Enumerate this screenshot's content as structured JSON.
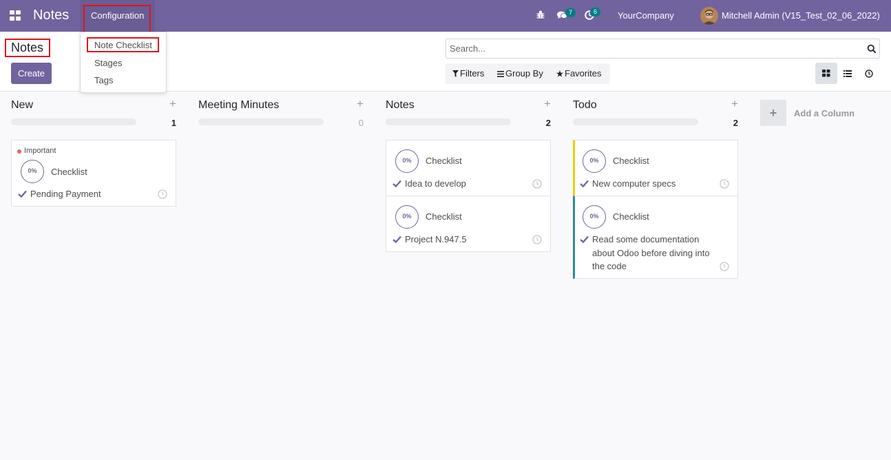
{
  "navbar": {
    "app_name": "Notes",
    "menu_configuration": "Configuration",
    "messages_count": "7",
    "activities_count": "6",
    "company": "YourCompany",
    "user": "Mitchell Admin (V15_Test_02_06_2022)"
  },
  "config_menu": {
    "items": [
      "Note Checklist",
      "Stages",
      "Tags"
    ]
  },
  "control_panel": {
    "title": "Notes",
    "create_label": "Create",
    "search_placeholder": "Search...",
    "filters_label": "Filters",
    "group_by_label": "Group By",
    "favorites_label": "Favorites"
  },
  "columns": [
    {
      "title": "New",
      "count": "1",
      "cards": [
        {
          "tag": "Important",
          "progress": "0%",
          "label": "Checklist",
          "text": "Pending Payment"
        }
      ]
    },
    {
      "title": "Meeting Minutes",
      "count": "0",
      "cards": []
    },
    {
      "title": "Notes",
      "count": "2",
      "cards": [
        {
          "progress": "0%",
          "label": "Checklist",
          "text": "Idea to develop"
        },
        {
          "progress": "0%",
          "label": "Checklist",
          "text": "Project N.947.5"
        }
      ]
    },
    {
      "title": "Todo",
      "count": "2",
      "cards": [
        {
          "progress": "0%",
          "label": "Checklist",
          "text": "New computer specs",
          "color": "#f3cc00"
        },
        {
          "progress": "0%",
          "label": "Checklist",
          "text": "Read some documentation about Odoo before diving into the code",
          "color": "#2e8c9a"
        }
      ]
    }
  ],
  "add_column_label": "Add a Column",
  "colors": {
    "brand": "#71639e",
    "badge": "#017e84",
    "highlight": "#e0131b",
    "important": "#f06050"
  },
  "icons": [
    "apps-icon",
    "bug-icon",
    "chat-icon",
    "activity-clock-icon",
    "search-icon",
    "filter-icon",
    "group-by-icon",
    "star-icon",
    "kanban-view-icon",
    "list-view-icon",
    "activity-view-icon",
    "check-icon",
    "clock-icon",
    "plus-icon"
  ]
}
